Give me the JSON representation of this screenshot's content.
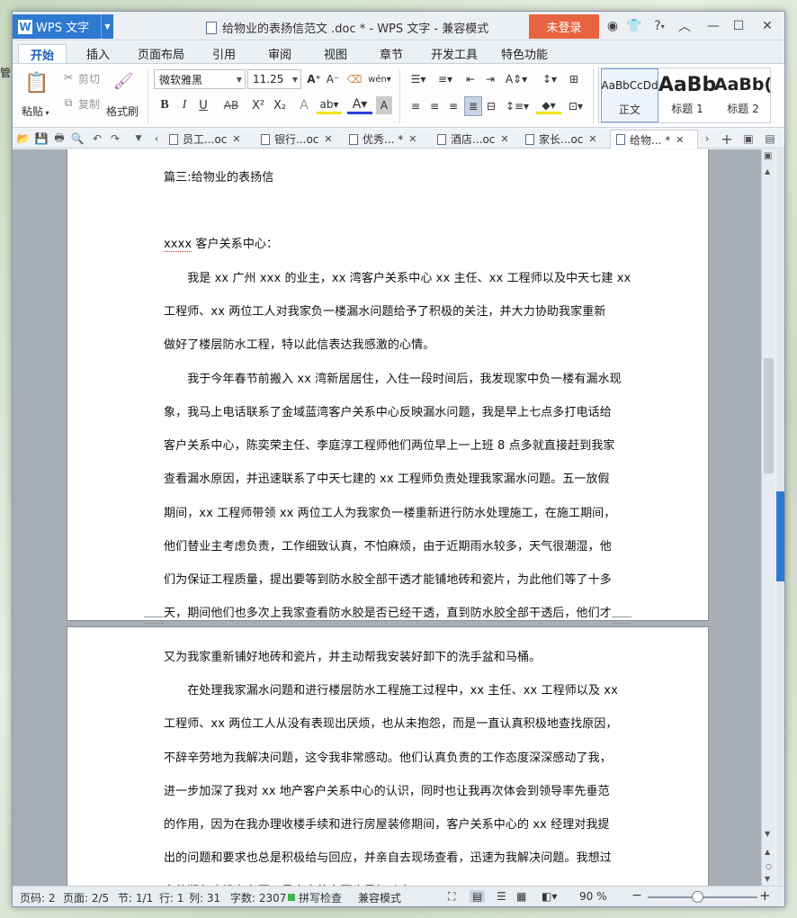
{
  "window": {
    "app_button": "WPS 文字",
    "title": "给物业的表扬信范文 .doc * - WPS 文字 - 兼容模式",
    "login_label": "未登录",
    "help_label": "?"
  },
  "menu_tabs": [
    "开始",
    "插入",
    "页面布局",
    "引用",
    "审阅",
    "视图",
    "章节",
    "开发工具",
    "特色功能"
  ],
  "ribbon": {
    "paste_label": "粘贴",
    "cut_label": "剪切",
    "copy_label": "复制",
    "format_painter_label": "格式刷",
    "font_name": "微软雅黑",
    "font_size": "11.25",
    "bold": "B",
    "italic": "I",
    "underline": "U",
    "strike": "AB",
    "superscript": "X²",
    "subscript": "X₂",
    "styles": [
      {
        "preview": "AaBbCcDd",
        "name": "正文"
      },
      {
        "preview": "AaBb",
        "name": "标题 1"
      },
      {
        "preview": "AaBb(",
        "name": "标题 2"
      }
    ]
  },
  "doc_tabs": [
    {
      "label": "员工...oc",
      "active": false
    },
    {
      "label": "银行...oc",
      "active": false
    },
    {
      "label": "优秀... *",
      "active": false
    },
    {
      "label": "酒店...oc",
      "active": false
    },
    {
      "label": "家长...oc",
      "active": false
    },
    {
      "label": "给物... *",
      "active": true
    }
  ],
  "document": {
    "page1_lines": [
      "篇三:给物业的表扬信",
      "",
      "xxxx 客户关系中心：",
      "　　我是 xx 广州 xxx 的业主，xx 湾客户关系中心 xx 主任、xx 工程师以及中天七建 xx",
      "工程师、xx 两位工人对我家负一楼漏水问题给予了积极的关注，并大力协助我家重新",
      "做好了楼层防水工程，特以此信表达我感激的心情。",
      "　　我于今年春节前搬入 xx 湾新居居住，入住一段时间后，我发现家中负一楼有漏水现",
      "象，我马上电话联系了金域蓝湾客户关系中心反映漏水问题，我是早上七点多打电话给",
      "客户关系中心，陈奕荣主任、李庭淳工程师他们两位早上一上班 8 点多就直接赶到我家",
      "查看漏水原因，并迅速联系了中天七建的 xx 工程师负责处理我家漏水问题。五一放假",
      "期间，xx 工程师带领 xx 两位工人为我家负一楼重新进行防水处理施工，在施工期间，",
      "他们替业主考虑负责，工作细致认真，不怕麻烦，由于近期雨水较多，天气很潮湿，他",
      "们为保证工程质量，提出要等到防水胶全部干透才能铺地砖和瓷片，为此他们等了十多",
      "天，期间他们也多次上我家查看防水胶是否已经干透，直到防水胶全部干透后，他们才"
    ],
    "page2_lines": [
      "又为我家重新铺好地砖和瓷片，并主动帮我安装好卸下的洗手盆和马桶。",
      "　　在处理我家漏水问题和进行楼层防水工程施工过程中，xx 主任、xx 工程师以及 xx",
      "工程师、xx 两位工人从没有表现出厌烦，也从未抱怨，而是一直认真积极地查找原因，",
      "不辞辛劳地为我解决问题，这令我非常感动。他们认真负责的工作态度深深感动了我，",
      "进一步加深了我对 xx 地产客户关系中心的认识，同时也让我再次体会到领导率先垂范",
      "的作用，因为在我办理收楼手续和进行房屋装修期间，客户关系中心的 xx 经理对我提",
      "出的问题和要求也总是积极给与回应，并亲自去现场查看，迅速为我解决问题。我想过",
      "多的润色也没有必要，最真实的东西也最打动人。"
    ]
  },
  "status": {
    "page_code": "页码: 2",
    "pages": "页面: 2/5",
    "section": "节: 1/1",
    "row": "行: 1",
    "col": "列: 31",
    "word_count": "字数: 2307",
    "spell_check": "拼写检查",
    "mode": "兼容模式",
    "zoom": "90 %"
  },
  "zoom_level": 0.5,
  "colors": {
    "accent": "#2f7ad1",
    "login": "#e8633f",
    "active_tab_text": "#1f5fb6"
  }
}
